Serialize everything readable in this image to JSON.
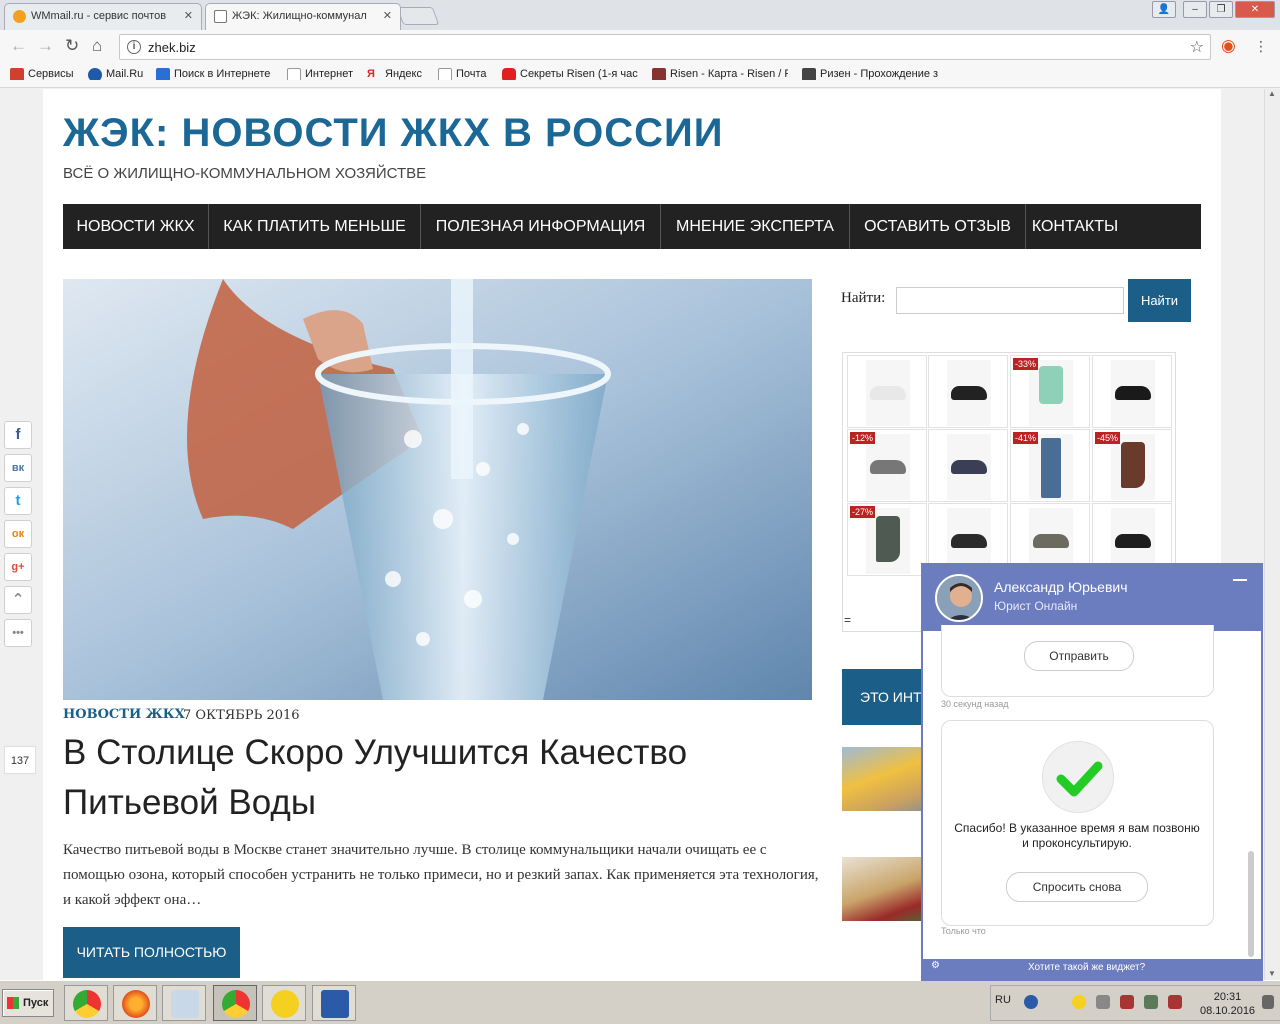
{
  "browser": {
    "tabs": [
      {
        "title": "WMmail.ru - сервис почтов",
        "active": false
      },
      {
        "title": "ЖЭК: Жилищно-коммунал",
        "active": true
      }
    ],
    "url": "zhek.biz",
    "bookmarks": [
      {
        "label": "Сервисы",
        "icon": "apps-grid-icon",
        "color": "#d04030"
      },
      {
        "label": "Mail.Ru",
        "icon": "mailru-icon",
        "color": "#1d5aa8"
      },
      {
        "label": "Поиск в Интернете",
        "icon": "search-icon",
        "color": "#2a6fd6"
      },
      {
        "label": "Интернет",
        "icon": "page-icon",
        "color": "#999999"
      },
      {
        "label": "Яндекс",
        "icon": "yandex-icon",
        "color": "#e02020"
      },
      {
        "label": "Почта",
        "icon": "page-icon",
        "color": "#999999"
      },
      {
        "label": "Секреты Risen (1-я час",
        "icon": "youtube-icon",
        "color": "#e02020"
      },
      {
        "label": "Risen - Карта - Risen / F",
        "icon": "rpg-icon",
        "color": "#883333"
      },
      {
        "label": "Ризен - Прохождение з",
        "icon": "w-icon",
        "color": "#444444"
      }
    ]
  },
  "site": {
    "title": "ЖЭК: НОВОСТИ ЖКХ В РОССИИ",
    "tagline": "ВСЁ О ЖИЛИЩНО-КОММУНАЛЬНОМ ХОЗЯЙСТВЕ",
    "accent": "#1b6796",
    "nav": [
      "НОВОСТИ ЖКХ",
      "КАК ПЛАТИТЬ МЕНЬШЕ",
      "ПОЛЕЗНАЯ ИНФОРМАЦИЯ",
      "МНЕНИЕ ЭКСПЕРТА",
      "ОСТАВИТЬ ОТЗЫВ",
      "КОНТАКТЫ"
    ]
  },
  "article": {
    "category": "НОВОСТИ ЖКХ",
    "date": "7 ОКТЯБРЬ 2016",
    "title": "В Столице Скоро Улучшится Качество Питьевой Воды",
    "excerpt": "Качество питьевой воды в Москве станет значительно лучше. В столице коммунальщики начали очищать ее с помощью озона, который способен устранить не только примеси, но и резкий запах. Как применяется эта технология, и какой эффект она…",
    "read_more": "ЧИТАТЬ ПОЛНОСТЬЮ"
  },
  "sidebar": {
    "search_label": "Найти:",
    "search_button": "Найти",
    "ad_items": [
      {
        "type": "shoe",
        "color": "#e8e8e8",
        "badge": ""
      },
      {
        "type": "shoe",
        "color": "#222222",
        "badge": ""
      },
      {
        "type": "tshirt",
        "color": "#8fd0b8",
        "badge": "-33%"
      },
      {
        "type": "shoe",
        "color": "#1a1a1a",
        "badge": ""
      },
      {
        "type": "shoe",
        "color": "#777777",
        "badge": "-12%"
      },
      {
        "type": "shoe",
        "color": "#3b3f55",
        "badge": ""
      },
      {
        "type": "jeans",
        "color": "#4a6d96",
        "badge": "-41%"
      },
      {
        "type": "boot",
        "color": "#6a3b2a",
        "badge": "-45%"
      },
      {
        "type": "boot",
        "color": "#4e5a52",
        "badge": "-27%"
      },
      {
        "type": "shoe",
        "color": "#2b2b2b",
        "badge": ""
      },
      {
        "type": "shoe",
        "color": "#6b6b60",
        "badge": ""
      },
      {
        "type": "shoe",
        "color": "#1e1e1e",
        "badge": ""
      }
    ],
    "ad_footer": "=",
    "box_text": "ЭТО ИНТ"
  },
  "share": {
    "buttons": [
      {
        "name": "facebook-icon",
        "glyph": "f",
        "color": "#3b5998"
      },
      {
        "name": "vk-icon",
        "glyph": "вк",
        "color": "#4c75a3"
      },
      {
        "name": "twitter-icon",
        "glyph": "t",
        "color": "#1da1f2"
      },
      {
        "name": "odnoklassniki-icon",
        "glyph": "ок",
        "color": "#ee8208"
      },
      {
        "name": "google-plus-icon",
        "glyph": "g+",
        "color": "#dd4b39"
      },
      {
        "name": "scroll-up-icon",
        "glyph": "⌃",
        "color": "#888888"
      },
      {
        "name": "more-icon",
        "glyph": "•••",
        "color": "#888888"
      }
    ],
    "count": "137"
  },
  "chat": {
    "name": "Александр Юрьевич",
    "subtitle": "Юрист Онлайн",
    "send_button": "Отправить",
    "timestamp_1": "30 секунд назад",
    "thanks": "Спасибо! В указанное время я вам позвоню и проконсультирую.",
    "ask_again": "Спросить снова",
    "timestamp_2": "Только что",
    "footer": "Хотите такой же виджет?",
    "color": "#6b7cbf"
  },
  "taskbar": {
    "start": "Пуск",
    "lang": "RU",
    "time": "20:31",
    "date": "08.10.2016"
  }
}
